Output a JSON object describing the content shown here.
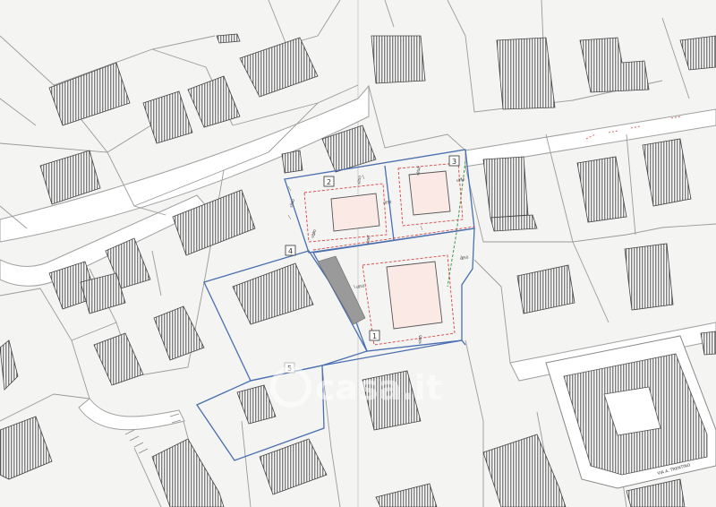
{
  "plot_labels": {
    "lot1": "1",
    "lot2": "2",
    "lot3": "3",
    "lot4": "4",
    "lot5": "5"
  },
  "dimensions": {
    "d1": "s850",
    "d2": "s850",
    "d3": "s850",
    "d4": "s850",
    "d5": "s850",
    "d6": "s850",
    "d7": "s850",
    "d8": "s850",
    "d9": "s850",
    "d10": "s850"
  },
  "street_label": "VIA A. TRENTINO",
  "watermark": "casa.it",
  "colors": {
    "paper": "#f4f4f2",
    "lines": "#9a9a9a",
    "building": "#555555",
    "boundary_blue": "#4a6fb0",
    "setback_red": "#d84444",
    "green_line": "#3a9a4a"
  }
}
